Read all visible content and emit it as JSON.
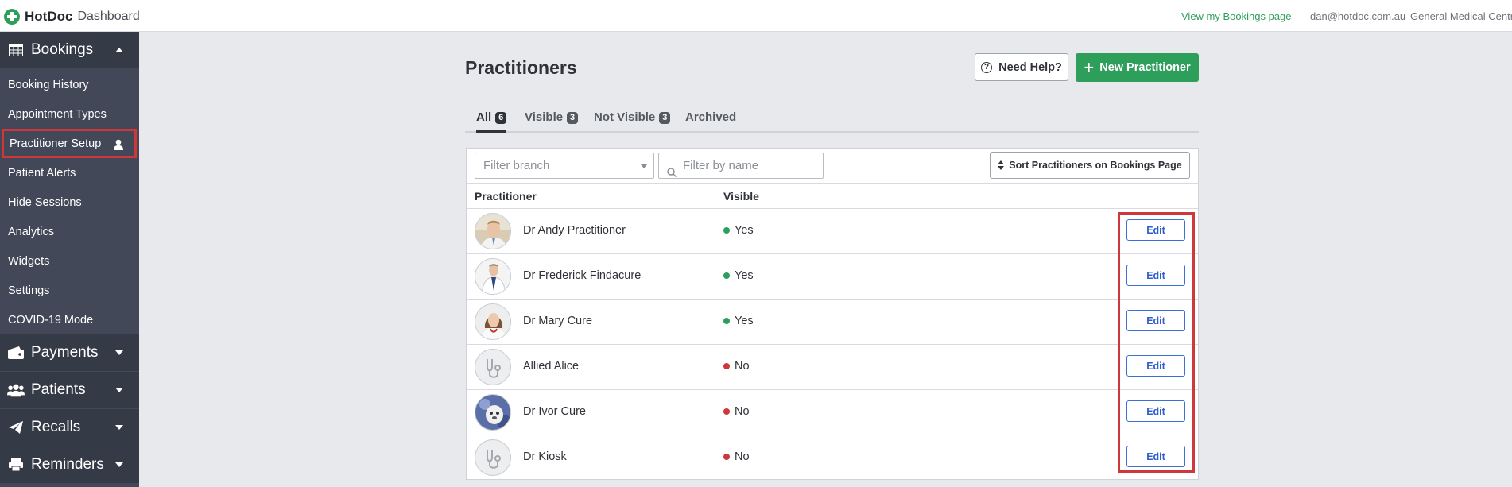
{
  "topbar": {
    "brand": "HotDoc",
    "subtitle": "Dashboard",
    "bookings_link": "View my Bookings page",
    "user_email": "dan@hotdoc.com.au",
    "clinic_name": "General Medical Centr"
  },
  "sidebar": {
    "sections": [
      {
        "label": "Bookings",
        "icon": "table-icon",
        "expanded": true
      },
      {
        "label": "Payments",
        "icon": "wallet-icon",
        "expanded": false
      },
      {
        "label": "Patients",
        "icon": "users-icon",
        "expanded": false
      },
      {
        "label": "Recalls",
        "icon": "paper-plane-icon",
        "expanded": false
      },
      {
        "label": "Reminders",
        "icon": "printer-icon",
        "expanded": false
      }
    ],
    "bookings_items": [
      {
        "label": "Booking History"
      },
      {
        "label": "Appointment Types"
      },
      {
        "label": "Practitioner Setup",
        "active": true
      },
      {
        "label": "Patient Alerts"
      },
      {
        "label": "Hide Sessions"
      },
      {
        "label": "Analytics"
      },
      {
        "label": "Widgets"
      },
      {
        "label": "Settings"
      },
      {
        "label": "COVID-19 Mode"
      }
    ]
  },
  "main": {
    "title": "Practitioners",
    "help_button": "Need Help?",
    "new_button": "New Practitioner",
    "tabs": [
      {
        "label": "All",
        "count": "6",
        "active": true
      },
      {
        "label": "Visible",
        "count": "3"
      },
      {
        "label": "Not Visible",
        "count": "3"
      },
      {
        "label": "Archived",
        "count": ""
      }
    ],
    "filter_branch_placeholder": "Filter branch",
    "filter_name_placeholder": "Filter by name",
    "sort_button": "Sort Practitioners on Bookings Page",
    "columns": [
      "Practitioner",
      "Visible"
    ],
    "edit_label": "Edit",
    "rows": [
      {
        "name": "Dr Andy Practitioner",
        "visible": "Yes",
        "status_color": "#2e9e5b",
        "avatar": "photo"
      },
      {
        "name": "Dr Frederick Findacure",
        "visible": "Yes",
        "status_color": "#2e9e5b",
        "avatar": "photo"
      },
      {
        "name": "Dr Mary Cure",
        "visible": "Yes",
        "status_color": "#2e9e5b",
        "avatar": "photo"
      },
      {
        "name": "Allied Alice",
        "visible": "No",
        "status_color": "#d0373a",
        "avatar": "stethoscope-icon"
      },
      {
        "name": "Dr Ivor Cure",
        "visible": "No",
        "status_color": "#d0373a",
        "avatar": "photo"
      },
      {
        "name": "Dr Kiosk",
        "visible": "No",
        "status_color": "#d0373a",
        "avatar": "stethoscope-icon"
      }
    ]
  },
  "colors": {
    "accent_green": "#2e9e5b",
    "sidebar_bg": "#424857",
    "highlight_red": "#d0373a",
    "edit_blue": "#2f5fc8"
  }
}
